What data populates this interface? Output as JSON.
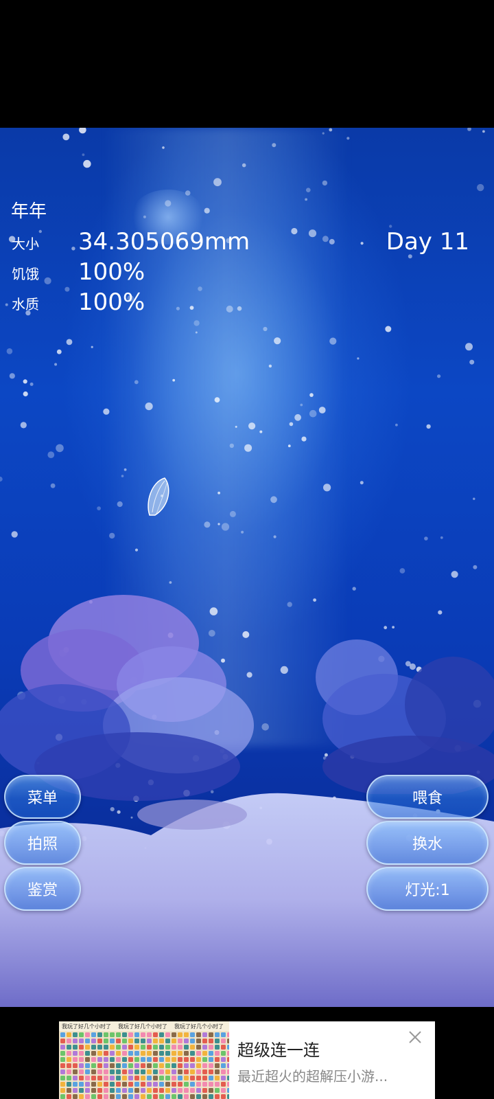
{
  "pet": {
    "name": "年年",
    "size_label": "大小",
    "size_value": "34.305069mm",
    "hunger_label": "饥饿",
    "hunger_value": "100%",
    "water_label": "水质",
    "water_value": "100%",
    "day": "Day 11"
  },
  "left_menu": {
    "menu": "菜单",
    "photo": "拍照",
    "gallery": "鉴赏"
  },
  "right_menu": {
    "feed": "喂食",
    "change_water": "换水",
    "light": "灯光:1"
  },
  "ad": {
    "title": "超级连一连",
    "description": "最近超火的超解压小游...",
    "image_caption": "我玩了好几个小时了",
    "close_icon": "close-icon"
  },
  "colors": {
    "water_deep": "#0a3aa8",
    "water_light": "#5fa8f5",
    "button_border": "#d2ebff",
    "coral": "#8f7fe0",
    "sand": "#c9c6f0"
  }
}
